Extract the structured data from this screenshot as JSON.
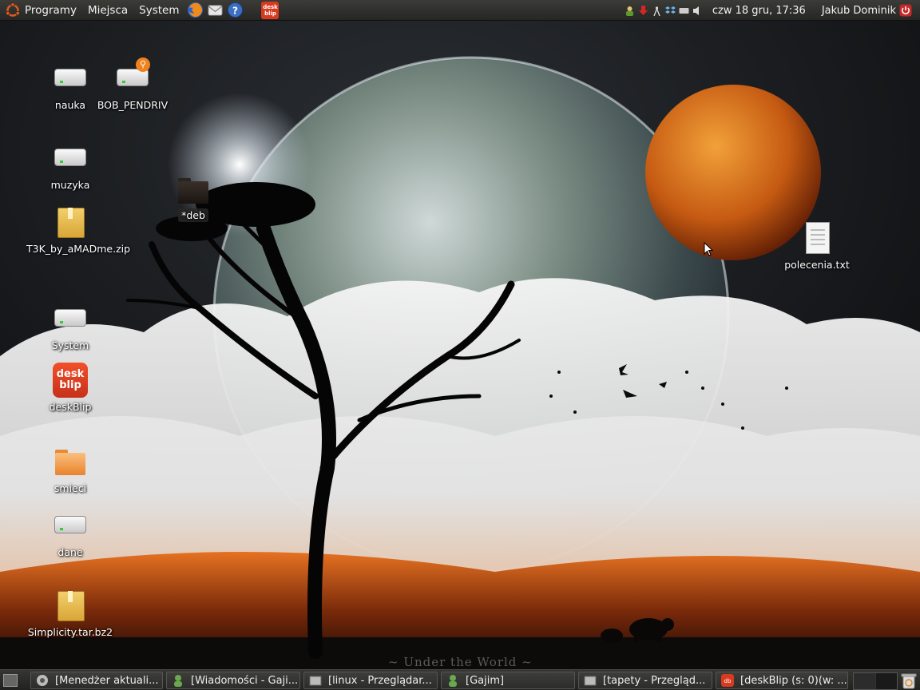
{
  "top_panel": {
    "menus": [
      {
        "label": "Programy",
        "icon": "ubuntu-logo-icon"
      },
      {
        "label": "Miejsca"
      },
      {
        "label": "System"
      }
    ],
    "launchers": [
      "firefox-icon",
      "mail-icon",
      "help-icon",
      "deskblip-launcher-icon"
    ],
    "launcher_brand": "desk blip",
    "tray_icons": [
      "user-status-icon",
      "download-icon",
      "network-icon",
      "dropbox-icon",
      "keyboard-icon",
      "volume-icon"
    ],
    "clock": "czw 18 gru, 17:36",
    "user": "Jakub Dominik"
  },
  "desktop_icons": [
    {
      "label": "nauka",
      "kind": "drive"
    },
    {
      "label": "BOB_PENDRIV",
      "kind": "usb-drive"
    },
    {
      "label": "muzyka",
      "kind": "drive"
    },
    {
      "label": "*deb",
      "kind": "folder-dark"
    },
    {
      "label": "T3K_by_aMADme.zip",
      "kind": "archive"
    },
    {
      "label": "System",
      "kind": "drive"
    },
    {
      "label": "deskBlip",
      "kind": "app",
      "logo": "desk blip"
    },
    {
      "label": "smieci",
      "kind": "folder-orange"
    },
    {
      "label": "dane",
      "kind": "drive"
    },
    {
      "label": "Simplicity.tar.bz2",
      "kind": "archive"
    },
    {
      "label": "polecenia.txt",
      "kind": "text-file"
    }
  ],
  "wallpaper": {
    "caption": "~ Under the World ~"
  },
  "taskbar": [
    {
      "label": "[Menedżer aktuali...",
      "icon": "update-manager-icon"
    },
    {
      "label": "[Wiadomości - Gaji...",
      "icon": "gajim-icon"
    },
    {
      "label": "[linux - Przeglądar...",
      "icon": "file-manager-icon"
    },
    {
      "label": "[Gajim]",
      "icon": "gajim-icon"
    },
    {
      "label": "[tapety - Przegląd...",
      "icon": "file-manager-icon"
    },
    {
      "label": "[deskBlip (s: 0)(w: ...",
      "icon": "deskblip-icon"
    }
  ],
  "colors": {
    "panel": "#2f2f2c",
    "ubuntu_orange": "#e05a1e",
    "deskblip_red": "#d93a1f"
  }
}
